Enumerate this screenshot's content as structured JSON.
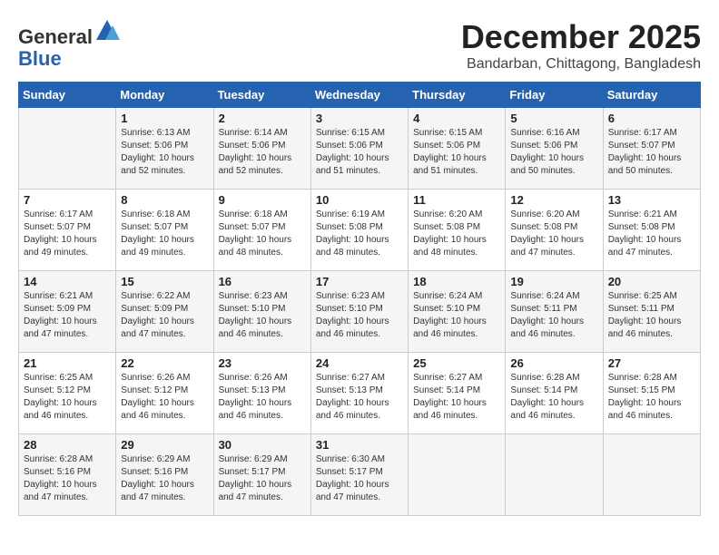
{
  "logo": {
    "general": "General",
    "blue": "Blue"
  },
  "title": "December 2025",
  "location": "Bandarban, Chittagong, Bangladesh",
  "weekdays": [
    "Sunday",
    "Monday",
    "Tuesday",
    "Wednesday",
    "Thursday",
    "Friday",
    "Saturday"
  ],
  "weeks": [
    [
      {
        "day": "",
        "sunrise": "",
        "sunset": "",
        "daylight": ""
      },
      {
        "day": "1",
        "sunrise": "Sunrise: 6:13 AM",
        "sunset": "Sunset: 5:06 PM",
        "daylight": "Daylight: 10 hours and 52 minutes."
      },
      {
        "day": "2",
        "sunrise": "Sunrise: 6:14 AM",
        "sunset": "Sunset: 5:06 PM",
        "daylight": "Daylight: 10 hours and 52 minutes."
      },
      {
        "day": "3",
        "sunrise": "Sunrise: 6:15 AM",
        "sunset": "Sunset: 5:06 PM",
        "daylight": "Daylight: 10 hours and 51 minutes."
      },
      {
        "day": "4",
        "sunrise": "Sunrise: 6:15 AM",
        "sunset": "Sunset: 5:06 PM",
        "daylight": "Daylight: 10 hours and 51 minutes."
      },
      {
        "day": "5",
        "sunrise": "Sunrise: 6:16 AM",
        "sunset": "Sunset: 5:06 PM",
        "daylight": "Daylight: 10 hours and 50 minutes."
      },
      {
        "day": "6",
        "sunrise": "Sunrise: 6:17 AM",
        "sunset": "Sunset: 5:07 PM",
        "daylight": "Daylight: 10 hours and 50 minutes."
      }
    ],
    [
      {
        "day": "7",
        "sunrise": "Sunrise: 6:17 AM",
        "sunset": "Sunset: 5:07 PM",
        "daylight": "Daylight: 10 hours and 49 minutes."
      },
      {
        "day": "8",
        "sunrise": "Sunrise: 6:18 AM",
        "sunset": "Sunset: 5:07 PM",
        "daylight": "Daylight: 10 hours and 49 minutes."
      },
      {
        "day": "9",
        "sunrise": "Sunrise: 6:18 AM",
        "sunset": "Sunset: 5:07 PM",
        "daylight": "Daylight: 10 hours and 48 minutes."
      },
      {
        "day": "10",
        "sunrise": "Sunrise: 6:19 AM",
        "sunset": "Sunset: 5:08 PM",
        "daylight": "Daylight: 10 hours and 48 minutes."
      },
      {
        "day": "11",
        "sunrise": "Sunrise: 6:20 AM",
        "sunset": "Sunset: 5:08 PM",
        "daylight": "Daylight: 10 hours and 48 minutes."
      },
      {
        "day": "12",
        "sunrise": "Sunrise: 6:20 AM",
        "sunset": "Sunset: 5:08 PM",
        "daylight": "Daylight: 10 hours and 47 minutes."
      },
      {
        "day": "13",
        "sunrise": "Sunrise: 6:21 AM",
        "sunset": "Sunset: 5:08 PM",
        "daylight": "Daylight: 10 hours and 47 minutes."
      }
    ],
    [
      {
        "day": "14",
        "sunrise": "Sunrise: 6:21 AM",
        "sunset": "Sunset: 5:09 PM",
        "daylight": "Daylight: 10 hours and 47 minutes."
      },
      {
        "day": "15",
        "sunrise": "Sunrise: 6:22 AM",
        "sunset": "Sunset: 5:09 PM",
        "daylight": "Daylight: 10 hours and 47 minutes."
      },
      {
        "day": "16",
        "sunrise": "Sunrise: 6:23 AM",
        "sunset": "Sunset: 5:10 PM",
        "daylight": "Daylight: 10 hours and 46 minutes."
      },
      {
        "day": "17",
        "sunrise": "Sunrise: 6:23 AM",
        "sunset": "Sunset: 5:10 PM",
        "daylight": "Daylight: 10 hours and 46 minutes."
      },
      {
        "day": "18",
        "sunrise": "Sunrise: 6:24 AM",
        "sunset": "Sunset: 5:10 PM",
        "daylight": "Daylight: 10 hours and 46 minutes."
      },
      {
        "day": "19",
        "sunrise": "Sunrise: 6:24 AM",
        "sunset": "Sunset: 5:11 PM",
        "daylight": "Daylight: 10 hours and 46 minutes."
      },
      {
        "day": "20",
        "sunrise": "Sunrise: 6:25 AM",
        "sunset": "Sunset: 5:11 PM",
        "daylight": "Daylight: 10 hours and 46 minutes."
      }
    ],
    [
      {
        "day": "21",
        "sunrise": "Sunrise: 6:25 AM",
        "sunset": "Sunset: 5:12 PM",
        "daylight": "Daylight: 10 hours and 46 minutes."
      },
      {
        "day": "22",
        "sunrise": "Sunrise: 6:26 AM",
        "sunset": "Sunset: 5:12 PM",
        "daylight": "Daylight: 10 hours and 46 minutes."
      },
      {
        "day": "23",
        "sunrise": "Sunrise: 6:26 AM",
        "sunset": "Sunset: 5:13 PM",
        "daylight": "Daylight: 10 hours and 46 minutes."
      },
      {
        "day": "24",
        "sunrise": "Sunrise: 6:27 AM",
        "sunset": "Sunset: 5:13 PM",
        "daylight": "Daylight: 10 hours and 46 minutes."
      },
      {
        "day": "25",
        "sunrise": "Sunrise: 6:27 AM",
        "sunset": "Sunset: 5:14 PM",
        "daylight": "Daylight: 10 hours and 46 minutes."
      },
      {
        "day": "26",
        "sunrise": "Sunrise: 6:28 AM",
        "sunset": "Sunset: 5:14 PM",
        "daylight": "Daylight: 10 hours and 46 minutes."
      },
      {
        "day": "27",
        "sunrise": "Sunrise: 6:28 AM",
        "sunset": "Sunset: 5:15 PM",
        "daylight": "Daylight: 10 hours and 46 minutes."
      }
    ],
    [
      {
        "day": "28",
        "sunrise": "Sunrise: 6:28 AM",
        "sunset": "Sunset: 5:16 PM",
        "daylight": "Daylight: 10 hours and 47 minutes."
      },
      {
        "day": "29",
        "sunrise": "Sunrise: 6:29 AM",
        "sunset": "Sunset: 5:16 PM",
        "daylight": "Daylight: 10 hours and 47 minutes."
      },
      {
        "day": "30",
        "sunrise": "Sunrise: 6:29 AM",
        "sunset": "Sunset: 5:17 PM",
        "daylight": "Daylight: 10 hours and 47 minutes."
      },
      {
        "day": "31",
        "sunrise": "Sunrise: 6:30 AM",
        "sunset": "Sunset: 5:17 PM",
        "daylight": "Daylight: 10 hours and 47 minutes."
      },
      {
        "day": "",
        "sunrise": "",
        "sunset": "",
        "daylight": ""
      },
      {
        "day": "",
        "sunrise": "",
        "sunset": "",
        "daylight": ""
      },
      {
        "day": "",
        "sunrise": "",
        "sunset": "",
        "daylight": ""
      }
    ]
  ]
}
